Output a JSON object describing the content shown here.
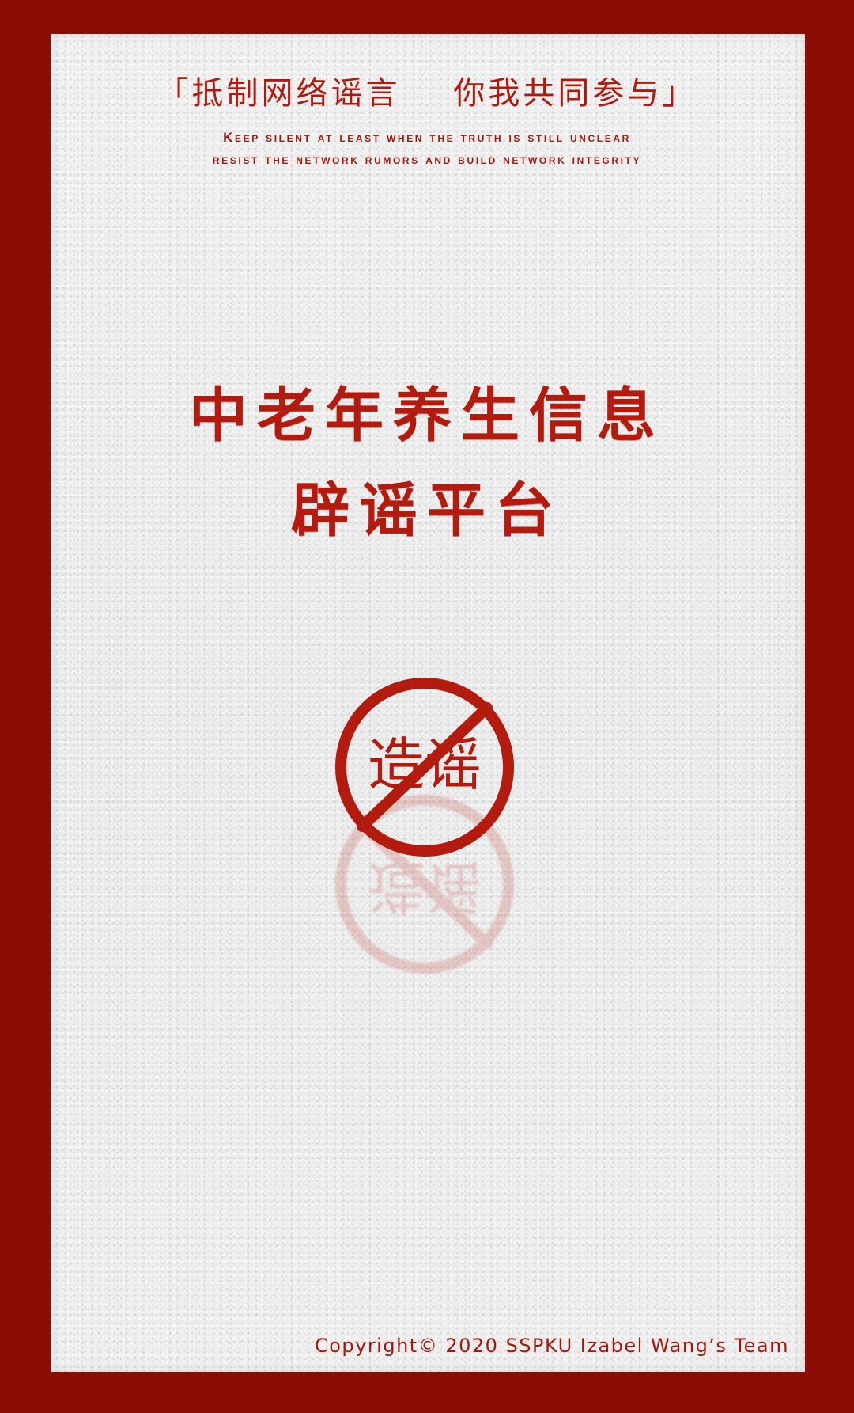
{
  "header": {
    "slogan": "「抵制网络谣言    你我共同参与」",
    "subline_1": "Keep silent at least when the truth is still unclear",
    "subline_2": "resist the network rumors and build network integrity"
  },
  "main": {
    "title_line_1": "中老年养生信息",
    "title_line_2": "辟谣平台"
  },
  "stamp": {
    "icon": "no-rumor-stamp-icon",
    "text": "造谣"
  },
  "footer": {
    "copyright": "Copyright© 2020 SSPKU Izabel Wang’s Team"
  },
  "colors": {
    "border_red": "#8b0d05",
    "accent_red": "#b31b0f",
    "paper": "#ececec"
  }
}
